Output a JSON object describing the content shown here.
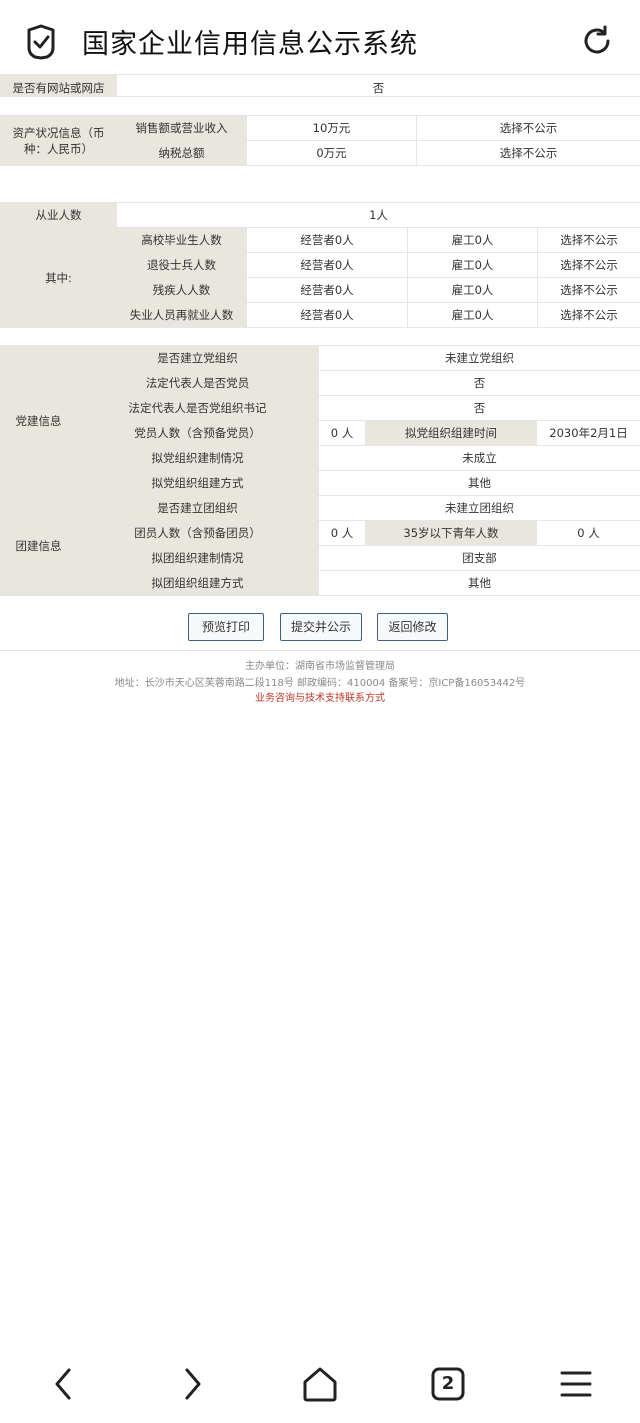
{
  "app": {
    "title": "国家企业信用信息公示系统"
  },
  "website_row": {
    "label": "是否有网站或网店",
    "value": "否"
  },
  "assets": {
    "label": "资产状况信息（币种：人民币）",
    "rows": [
      {
        "label": "销售额或营业收入",
        "value": "10万元",
        "status": "选择不公示"
      },
      {
        "label": "纳税总额",
        "value": "0万元",
        "status": "选择不公示"
      }
    ]
  },
  "employees": {
    "label": "从业人数",
    "value": "1人",
    "sub_label": "其中:",
    "rows": [
      {
        "label": "高校毕业生人数",
        "operator": "经营者0人",
        "employee": "雇工0人",
        "status": "选择不公示"
      },
      {
        "label": "退役士兵人数",
        "operator": "经营者0人",
        "employee": "雇工0人",
        "status": "选择不公示"
      },
      {
        "label": "残疾人人数",
        "operator": "经营者0人",
        "employee": "雇工0人",
        "status": "选择不公示"
      },
      {
        "label": "失业人员再就业人数",
        "operator": "经营者0人",
        "employee": "雇工0人",
        "status": "选择不公示"
      }
    ]
  },
  "party": {
    "label": "党建信息",
    "established_label": "是否建立党组织",
    "established_value": "未建立党组织",
    "rep_member_label": "法定代表人是否党员",
    "rep_member_value": "否",
    "rep_secretary_label": "法定代表人是否党组织书记",
    "rep_secretary_value": "否",
    "members_label": "党员人数（含预备党员）",
    "members_value": "0 人",
    "plan_time_label": "拟党组织组建时间",
    "plan_time_value": "2030年2月1日",
    "plan_status_label": "拟党组织建制情况",
    "plan_status_value": "未成立",
    "plan_method_label": "拟党组织组建方式",
    "plan_method_value": "其他"
  },
  "league": {
    "label": "团建信息",
    "established_label": "是否建立团组织",
    "established_value": "未建立团组织",
    "members_label": "团员人数（含预备团员）",
    "members_value": "0 人",
    "youth_label": "35岁以下青年人数",
    "youth_value": "0 人",
    "plan_status_label": "拟团组织建制情况",
    "plan_status_value": "团支部",
    "plan_method_label": "拟团组织组建方式",
    "plan_method_value": "其他"
  },
  "buttons": {
    "preview": "预览打印",
    "submit": "提交并公示",
    "back": "返回修改"
  },
  "footer": {
    "host": "主办单位：湖南省市场监督管理局",
    "address": "地址：长沙市天心区芙蓉南路二段118号 邮政编码：410004 备案号：京ICP备16053442号",
    "contact": "业务咨询与技术支持联系方式"
  },
  "nav": {
    "tabs_count": "2"
  },
  "colors": {
    "label_bg": "#e9e6dd",
    "button_border": "#3f5f86",
    "contact_red": "#c0392b"
  }
}
